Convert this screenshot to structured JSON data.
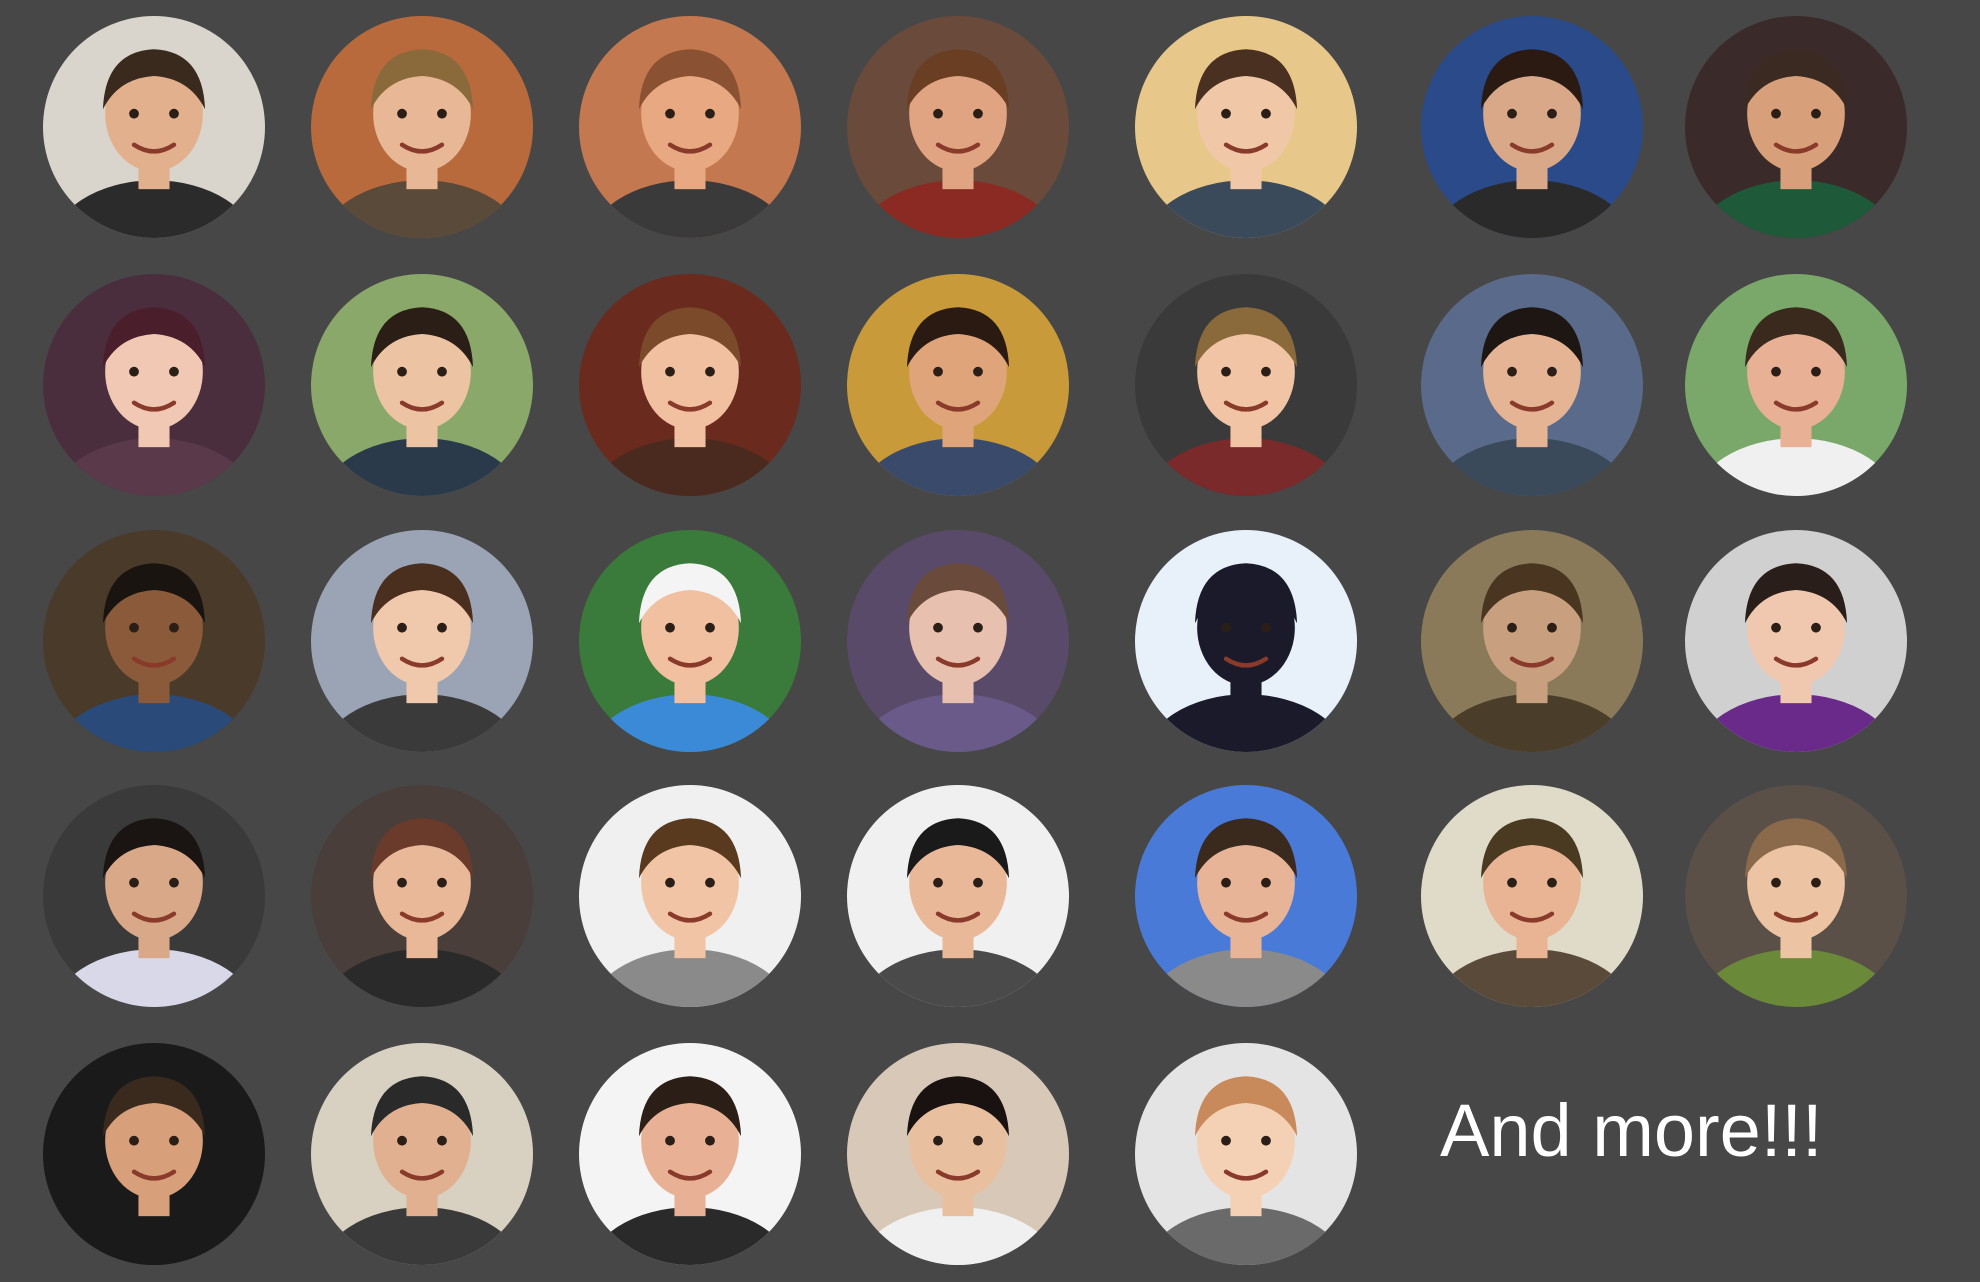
{
  "more_text": "And more!!!",
  "avatars": [
    {
      "bg": "#d9d4cc",
      "skin": "#e3b08e",
      "hair": "#3a2a1e",
      "shirt": "#2b2b2b"
    },
    {
      "bg": "#b86a3c",
      "skin": "#e8b896",
      "hair": "#8a6a3a",
      "shirt": "#5a4a3a"
    },
    {
      "bg": "#c47850",
      "skin": "#e8a882",
      "hair": "#8a5232",
      "shirt": "#3a3a3a"
    },
    {
      "bg": "#6a4a3a",
      "skin": "#e0a482",
      "hair": "#6a3e22",
      "shirt": "#8a2a22"
    },
    {
      "bg": "#e8c88a",
      "skin": "#f0c8a8",
      "hair": "#4a3020",
      "shirt": "#3a4a5a"
    },
    {
      "bg": "#2a4a8a",
      "skin": "#d8a888",
      "hair": "#2a1a12",
      "shirt": "#2a2a2a"
    },
    {
      "bg": "#3a2a2a",
      "skin": "#d8a07a",
      "hair": "#3a2a22",
      "shirt": "#1e5a3a"
    },
    {
      "bg": "#4a2e3e",
      "skin": "#f0c8b4",
      "hair": "#4a1e2a",
      "shirt": "#5a3a4a"
    },
    {
      "bg": "#8aa86a",
      "skin": "#ecc4a4",
      "hair": "#2a1e16",
      "shirt": "#2a3a4a"
    },
    {
      "bg": "#6a2a1e",
      "skin": "#f0c0a0",
      "hair": "#7a4a2a",
      "shirt": "#4a2a1e"
    },
    {
      "bg": "#c89a3a",
      "skin": "#e0a47a",
      "hair": "#2a1a12",
      "shirt": "#3a4a6a"
    },
    {
      "bg": "#3a3a3a",
      "skin": "#f0c4a4",
      "hair": "#8a6a3a",
      "shirt": "#7a2a2a"
    },
    {
      "bg": "#5a6a8a",
      "skin": "#e4b494",
      "hair": "#1e1612",
      "shirt": "#3a4a5a"
    },
    {
      "bg": "#7aa86a",
      "skin": "#e8b094",
      "hair": "#3a2a1e",
      "shirt": "#f0f0f0"
    },
    {
      "bg": "#4a3a2a",
      "skin": "#8a5a3a",
      "hair": "#1a1410",
      "shirt": "#2a4a7a"
    },
    {
      "bg": "#9aa4b4",
      "skin": "#f0c8ac",
      "hair": "#4a2e1e",
      "shirt": "#3a3a3a"
    },
    {
      "bg": "#3a7a3a",
      "skin": "#f0c0a0",
      "hair": "#f4f4f4",
      "shirt": "#3a8ad8"
    },
    {
      "bg": "#5a4a6a",
      "skin": "#e8c0b0",
      "hair": "#6a4a3a",
      "shirt": "#6a5a8a"
    },
    {
      "bg": "#e8f0fa",
      "skin": "#1a1a2a",
      "hair": "#1a1a2a",
      "shirt": "#1a1a2a"
    },
    {
      "bg": "#8a7a5a",
      "skin": "#c8a080",
      "hair": "#4a3620",
      "shirt": "#4a3e2a"
    },
    {
      "bg": "#d0d0d0",
      "skin": "#f0c8b0",
      "hair": "#2a1e1a",
      "shirt": "#6a2a8a"
    },
    {
      "bg": "#3a3a3a",
      "skin": "#d8a888",
      "hair": "#1a1412",
      "shirt": "#d8d8e8"
    },
    {
      "bg": "#4a3e3a",
      "skin": "#e8b898",
      "hair": "#6a3a2a",
      "shirt": "#2a2a2a"
    },
    {
      "bg": "#f0f0f0",
      "skin": "#f0c4a4",
      "hair": "#5a3a1e",
      "shirt": "#8a8a8a"
    },
    {
      "bg": "#f0f0f0",
      "skin": "#e8b898",
      "hair": "#1a1a1a",
      "shirt": "#4a4a4a"
    },
    {
      "bg": "#4a7ad8",
      "skin": "#e8b498",
      "hair": "#3a2a1e",
      "shirt": "#8a8a8a"
    },
    {
      "bg": "#e0dac8",
      "skin": "#e8b494",
      "hair": "#4a3a22",
      "shirt": "#5a4a3a"
    },
    {
      "bg": "#5a5048",
      "skin": "#ecc4a4",
      "hair": "#8a6a4a",
      "shirt": "#6a8a3a"
    },
    {
      "bg": "#1a1a1a",
      "skin": "#d8a07a",
      "hair": "#3a2a1e",
      "shirt": "#1a1a1a"
    },
    {
      "bg": "#d8d0c0",
      "skin": "#e0b090",
      "hair": "#2a2a2a",
      "shirt": "#3a3a3a"
    },
    {
      "bg": "#f4f4f4",
      "skin": "#e8b094",
      "hair": "#2a1e16",
      "shirt": "#2a2a2a"
    },
    {
      "bg": "#d8c8b8",
      "skin": "#e8c0a0",
      "hair": "#1a1210",
      "shirt": "#f0f0f0"
    },
    {
      "bg": "#e4e4e4",
      "skin": "#f4d0b4",
      "hair": "#c88a5a",
      "shirt": "#6a6a6a"
    }
  ]
}
